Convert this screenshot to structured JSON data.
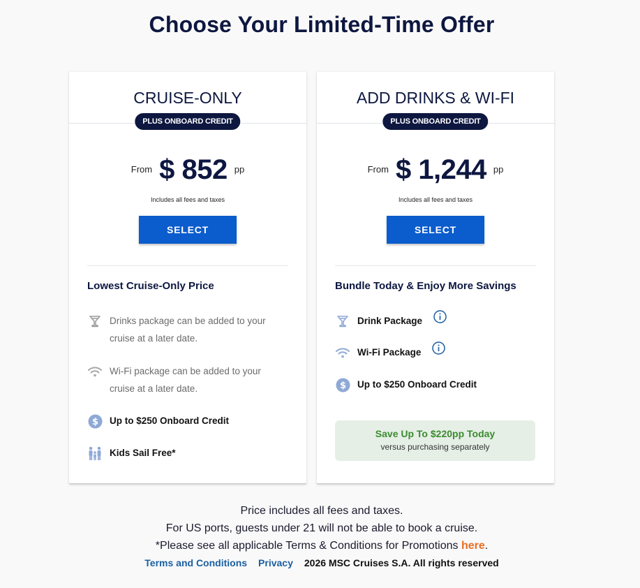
{
  "page": {
    "title": "Choose Your Limited-Time Offer"
  },
  "offers": [
    {
      "title": "CRUISE-ONLY",
      "badge": "PLUS ONBOARD CREDIT",
      "price_prefix": "From",
      "price": "$ 852",
      "price_suffix": "pp",
      "fees_note": "Includes all fees and taxes",
      "select_label": "SELECT",
      "subhead": "Lowest Cruise-Only Price",
      "features": [
        {
          "icon": "cocktail-icon",
          "text": "Drinks package can be added to your cruise at a later date."
        },
        {
          "icon": "wifi-icon",
          "text": "Wi-Fi package can be added to your cruise at a later date."
        },
        {
          "icon": "dollar-coin-icon",
          "text": "Up to $250 Onboard Credit"
        },
        {
          "icon": "family-icon",
          "text": "Kids Sail Free*"
        }
      ]
    },
    {
      "title": "ADD DRINKS & WI-FI",
      "badge": "PLUS ONBOARD CREDIT",
      "price_prefix": "From",
      "price": "$ 1,244",
      "price_suffix": "pp",
      "fees_note": "Includes all fees and taxes",
      "select_label": "SELECT",
      "subhead": "Bundle Today & Enjoy More Savings",
      "features": [
        {
          "icon": "cocktail-icon",
          "text": "Drink Package"
        },
        {
          "icon": "wifi-icon",
          "text": "Wi-Fi Package"
        },
        {
          "icon": "dollar-coin-icon",
          "text": "Up to $250 Onboard Credit"
        }
      ],
      "savings": {
        "title": "Save Up To $220pp Today",
        "subtitle": "versus purchasing separately"
      }
    }
  ],
  "footer": {
    "line1": "Price includes all fees and taxes.",
    "line2": "For US ports, guests under 21 will not be able to book a cruise.",
    "line3_prefix": "*Please see all applicable Terms & Conditions for Promotions ",
    "line3_link": "here",
    "line3_suffix": ".",
    "terms_link": "Terms and Conditions",
    "privacy_link": "Privacy",
    "copyright": "2026 MSC Cruises S.A. All rights reserved"
  },
  "colors": {
    "navy": "#0d1740",
    "button_blue": "#0b5ccc",
    "icon_blue": "#8fa9d6",
    "savings_green": "#3b8b2f",
    "savings_bg": "#e5efe6",
    "link_orange": "#ea6d21"
  }
}
